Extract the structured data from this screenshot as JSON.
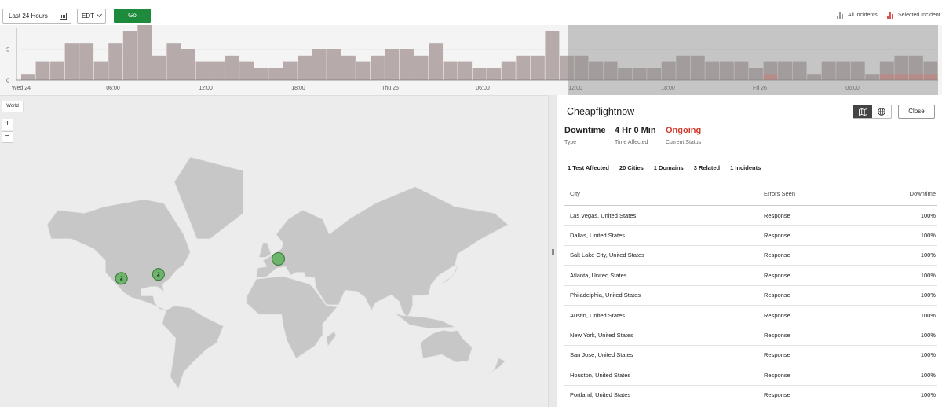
{
  "toolbar": {
    "time_range": "Last 24 Hours",
    "timezone": "EDT",
    "go_label": "Go",
    "legend_all": "All Incidents",
    "legend_selected": "Selected Incident"
  },
  "histogram": {
    "y_ticks": [
      "5",
      "0"
    ],
    "x_labels": [
      "Wed 24",
      "06:00",
      "12:00",
      "18:00",
      "Thu 25",
      "06:00",
      "12:00",
      "18:00",
      "Fri 26",
      "06:00"
    ],
    "values": [
      1,
      3,
      3,
      6,
      6,
      3,
      6,
      8,
      9,
      4,
      6,
      5,
      3,
      3,
      4,
      3,
      2,
      2,
      3,
      4,
      5,
      5,
      4,
      3,
      4,
      5,
      5,
      4,
      6,
      3,
      3,
      2,
      2,
      3,
      4,
      4,
      8,
      4,
      4,
      3,
      3,
      2,
      2,
      2,
      3,
      4,
      4,
      3,
      3,
      3,
      2,
      3,
      3,
      3,
      1,
      3,
      3,
      3,
      1,
      3,
      4,
      4,
      3
    ],
    "selected_values": [
      0,
      0,
      0,
      0,
      0,
      0,
      0,
      0,
      0,
      0,
      0,
      0,
      0,
      0,
      0,
      0,
      0,
      0,
      0,
      0,
      0,
      0,
      0,
      0,
      0,
      0,
      0,
      0,
      0,
      0,
      0,
      0,
      0,
      0,
      0,
      0,
      0,
      0,
      0,
      0,
      0,
      0,
      0,
      0,
      0,
      0,
      0,
      0,
      0,
      0,
      0,
      1,
      0,
      0,
      0,
      0,
      0,
      0,
      0,
      1,
      1,
      1,
      1
    ],
    "colors": {
      "bar": "#b7aaaa",
      "selected": "#d98a86",
      "overlay": "#8c8c8c"
    }
  },
  "map": {
    "world_label": "World",
    "zoom_in": "+",
    "zoom_out": "−",
    "clusters": [
      {
        "label": "2",
        "lat": 35.5,
        "lon": -112
      },
      {
        "label": "2",
        "lat": 38.5,
        "lon": -84
      },
      {
        "label": "",
        "lat": 49,
        "lon": 6.5
      }
    ],
    "colors": {
      "ocean": "#ececec",
      "land": "#c7c7c7",
      "marker": "#6db56d"
    }
  },
  "detail": {
    "title": "Cheapflightnow",
    "close_label": "Close",
    "stats": [
      {
        "value": "Downtime",
        "label": "Type"
      },
      {
        "value": "4 Hr 0 Min",
        "label": "Time Affected"
      },
      {
        "value": "Ongoing",
        "label": "Current Status"
      }
    ],
    "tabs": [
      "1 Test Affected",
      "20 Cities",
      "1 Domains",
      "3 Related",
      "1 Incidents"
    ],
    "columns": [
      "City",
      "Errors Seen",
      "Downtime"
    ],
    "rows": [
      [
        "Las Vegas, United States",
        "Response",
        "100%"
      ],
      [
        "Dallas, United States",
        "Response",
        "100%"
      ],
      [
        "Salt Lake City, United States",
        "Response",
        "100%"
      ],
      [
        "Atlanta, United States",
        "Response",
        "100%"
      ],
      [
        "Philadelphia, United States",
        "Response",
        "100%"
      ],
      [
        "Austin, United States",
        "Response",
        "100%"
      ],
      [
        "New York, United States",
        "Response",
        "100%"
      ],
      [
        "San Jose, United States",
        "Response",
        "100%"
      ],
      [
        "Houston, United States",
        "Response",
        "100%"
      ],
      [
        "Portland, United States",
        "Response",
        "100%"
      ]
    ],
    "colors": {
      "ongoing": "#d23a2c"
    }
  }
}
